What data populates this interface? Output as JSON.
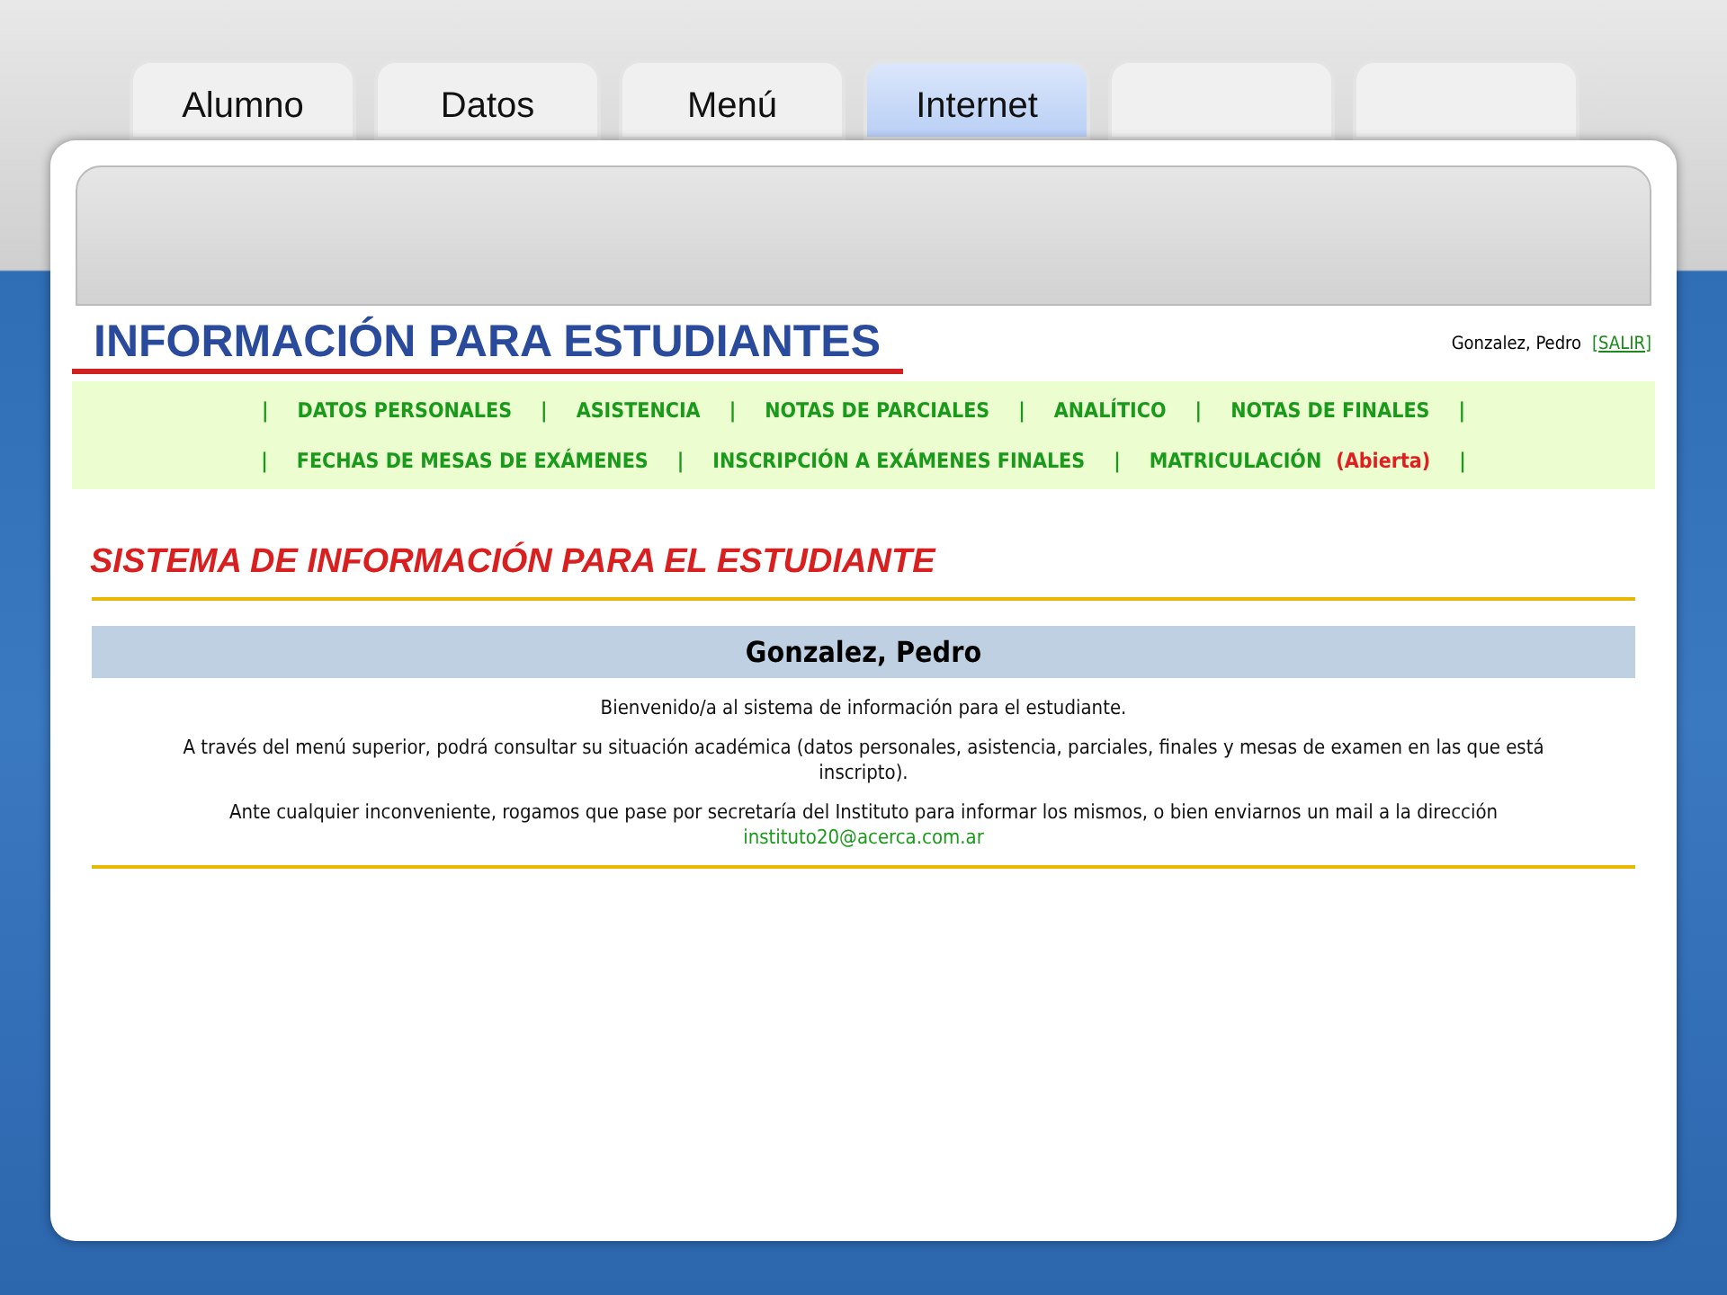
{
  "tabs": [
    {
      "label": "Alumno",
      "selected": false
    },
    {
      "label": "Datos",
      "selected": false
    },
    {
      "label": "Menú",
      "selected": false
    },
    {
      "label": "Internet",
      "selected": true
    },
    {
      "selected": false
    },
    {
      "selected": false
    }
  ],
  "site": {
    "title": "INFORMACIÓN PARA ESTUDIANTES",
    "user": "Gonzalez, Pedro",
    "logout": "[SALIR]"
  },
  "nav": {
    "separator": "|",
    "lines": [
      {
        "links": [
          {
            "label": "DATOS PERSONALES"
          },
          {
            "label": "ASISTENCIA"
          },
          {
            "label": "NOTAS DE PARCIALES"
          },
          {
            "label": "ANALÍTICO"
          },
          {
            "label": "NOTAS DE FINALES"
          }
        ]
      },
      {
        "links": [
          {
            "label": "FECHAS DE MESAS DE EXÁMENES"
          },
          {
            "label": "INSCRIPCIÓN A EXÁMENES FINALES"
          },
          {
            "label": "MATRICULACIÓN",
            "note": "(Abierta)"
          }
        ]
      }
    ]
  },
  "heading": "SISTEMA DE INFORMACIÓN PARA EL ESTUDIANTE",
  "student_name": "Gonzalez, Pedro",
  "paragraphs": [
    "Bienvenido/a al sistema de información para el estudiante.",
    "A través del menú superior, podrá consultar su situación académica (datos personales, asistencia, parciales, finales y mesas de examen en las que está inscripto).",
    "Ante cualquier inconveniente, rogamos que pase por secretaría del Instituto para informar los mismos, o bien enviarnos un mail a la dirección"
  ],
  "email": "instituto20@acerca.com.ar"
}
